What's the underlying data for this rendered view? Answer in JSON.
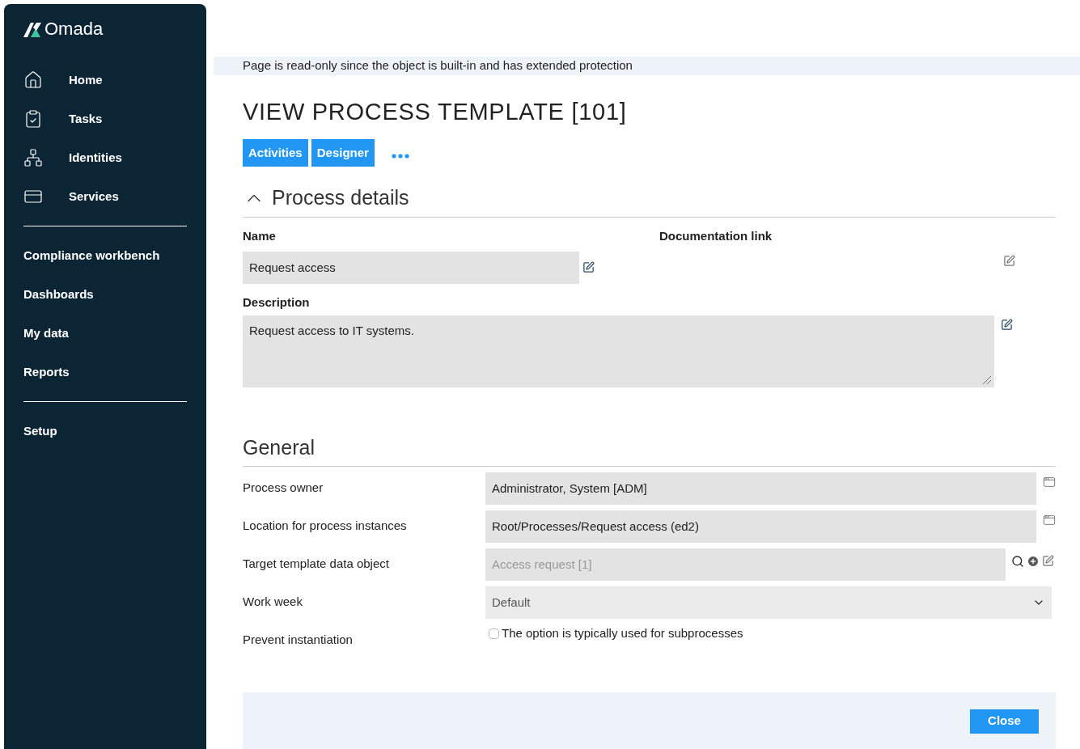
{
  "sidebar": {
    "logo": "Omada",
    "groups": [
      {
        "items": [
          {
            "label": "Home"
          },
          {
            "label": "Tasks"
          },
          {
            "label": "Identities"
          },
          {
            "label": "Services"
          }
        ]
      },
      {
        "items": [
          {
            "label": "Compliance workbench"
          },
          {
            "label": "Dashboards"
          },
          {
            "label": "My data"
          },
          {
            "label": "Reports"
          }
        ]
      },
      {
        "items": [
          {
            "label": "Setup"
          }
        ]
      }
    ]
  },
  "notice": "Page is read-only since the object is built-in and has extended protection",
  "title": "VIEW PROCESS TEMPLATE [101]",
  "tabs": [
    {
      "label": "Activities"
    },
    {
      "label": "Designer"
    }
  ],
  "process_details": {
    "title": "Process details",
    "expanded": true,
    "name": {
      "label": "Name",
      "value": "Request access"
    },
    "documentation_link": {
      "label": "Documentation link"
    },
    "description": {
      "label": "Description",
      "value": "Request access to IT systems."
    }
  },
  "general": {
    "title": "General",
    "fields": [
      {
        "kind": "picker",
        "label": "Process owner",
        "value": "Administrator, System [ADM]"
      },
      {
        "kind": "picker",
        "label": "Location for process instances",
        "value": "Root/Processes/Request access (ed2)"
      },
      {
        "kind": "lookup",
        "label": "Target template data object",
        "value": "Access request [1]",
        "disabled": true
      },
      {
        "kind": "select",
        "label": "Work week",
        "value": "Default"
      },
      {
        "kind": "checkbox",
        "label": "Prevent instantiation",
        "text": "The option is typically used for subprocesses",
        "checked": false
      }
    ]
  },
  "footer": {
    "button": "Close"
  }
}
